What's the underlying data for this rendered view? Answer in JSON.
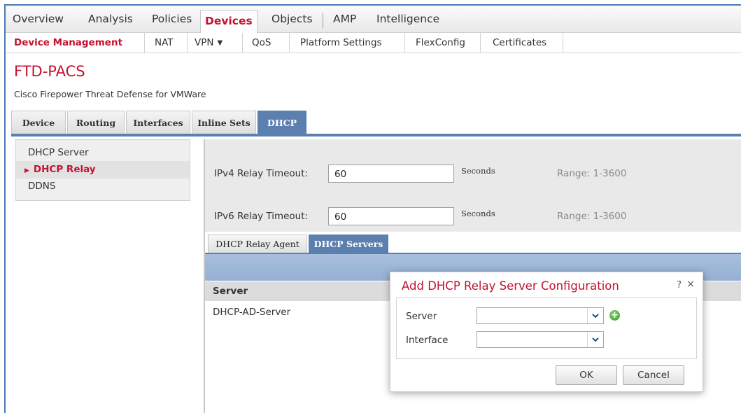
{
  "top_nav": {
    "items": [
      "Overview",
      "Analysis",
      "Policies",
      "Devices",
      "Objects",
      "AMP",
      "Intelligence"
    ],
    "active": "Devices"
  },
  "sub_nav": {
    "items": [
      "Device Management",
      "NAT",
      "VPN",
      "QoS",
      "Platform Settings",
      "FlexConfig",
      "Certificates"
    ],
    "active": "Device Management"
  },
  "device": {
    "name": "FTD-PACS",
    "description": "Cisco Firepower Threat Defense for VMWare"
  },
  "device_tabs": {
    "items": [
      "Device",
      "Routing",
      "Interfaces",
      "Inline Sets",
      "DHCP"
    ],
    "active": "DHCP"
  },
  "left_nav": {
    "items": [
      "DHCP Server",
      "DHCP Relay",
      "DDNS"
    ],
    "active": "DHCP Relay"
  },
  "relay_settings": {
    "ipv4": {
      "label": "IPv4 Relay Timeout:",
      "value": "60",
      "unit": "Seconds",
      "range": "Range: 1-3600"
    },
    "ipv6": {
      "label": "IPv6 Relay Timeout:",
      "value": "60",
      "unit": "Seconds",
      "range": "Range: 1-3600"
    }
  },
  "inner_tabs": {
    "items": [
      "DHCP Relay Agent",
      "DHCP Servers"
    ],
    "active": "DHCP Servers"
  },
  "server_table": {
    "column_header": "Server",
    "rows": [
      "DHCP-AD-Server"
    ]
  },
  "modal": {
    "title": "Add DHCP Relay Server Configuration",
    "help": "?",
    "close": "×",
    "fields": {
      "server": {
        "label": "Server",
        "value": ""
      },
      "interface": {
        "label": "Interface",
        "value": ""
      }
    },
    "ok_label": "OK",
    "cancel_label": "Cancel"
  },
  "colors": {
    "brand_red": "#c4122f",
    "tab_blue": "#5b7fae",
    "add_green": "#3e9c2c"
  }
}
